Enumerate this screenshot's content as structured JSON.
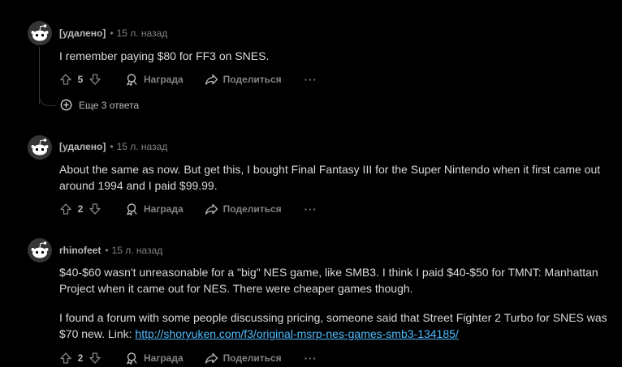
{
  "comments": [
    {
      "author": "[удалено]",
      "time": "15 л. назад",
      "paragraphs": [
        "I remember paying $80 for FF3 on SNES."
      ],
      "score": "5",
      "award_label": "Награда",
      "share_label": "Поделиться",
      "more_label": "···",
      "more_replies": "Еще 3 ответа"
    },
    {
      "author": "[удалено]",
      "time": "15 л. назад",
      "paragraphs": [
        "About the same as now. But get this, I bought Final Fantasy III for the Super Nintendo when it first came out around 1994 and I paid $99.99."
      ],
      "score": "2",
      "award_label": "Награда",
      "share_label": "Поделиться",
      "more_label": "···"
    },
    {
      "author": "rhinofeet",
      "time": "15 л. назад",
      "paragraphs": [
        "$40-$60 wasn't unreasonable for a \"big\" NES game, like SMB3. I think I paid $40-$50 for TMNT: Manhattan Project when it came out for NES. There were cheaper games though.",
        "I found a forum with some people discussing pricing, someone said that Street Fighter 2 Turbo for SNES was $70 new. Link: "
      ],
      "link": "http://shoryuken.com/f3/original-msrp-nes-games-smb3-134185/",
      "score": "2",
      "award_label": "Награда",
      "share_label": "Поделиться",
      "more_label": "···"
    }
  ],
  "dot": "•",
  "colors": {
    "background": "#000000",
    "text": "#d7dadc",
    "muted": "#818384",
    "link": "#4fbcff"
  },
  "icons": [
    "reddit-snoo-avatar-icon",
    "upvote-arrow-icon",
    "downvote-arrow-icon",
    "award-icon",
    "share-arrow-icon",
    "plus-circle-icon"
  ]
}
